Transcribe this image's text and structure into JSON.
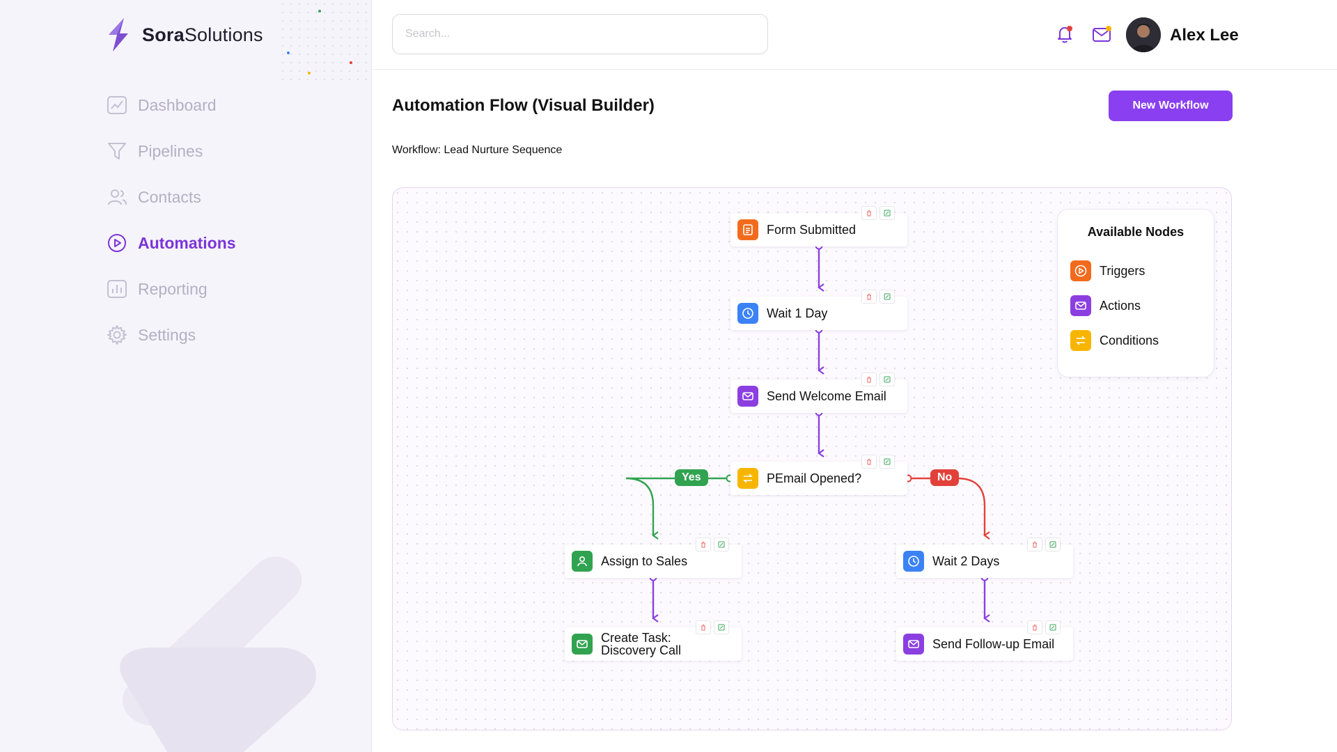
{
  "brand": {
    "name_bold": "Sora",
    "name_rest": "Solutions"
  },
  "search": {
    "placeholder": "Search..."
  },
  "user": {
    "name": "Alex Lee"
  },
  "sidebar": {
    "items": [
      {
        "label": "Dashboard",
        "icon": "chart-icon",
        "active": false
      },
      {
        "label": "Pipelines",
        "icon": "funnel-icon",
        "active": false
      },
      {
        "label": "Contacts",
        "icon": "users-icon",
        "active": false
      },
      {
        "label": "Automations",
        "icon": "play-circle-icon",
        "active": true
      },
      {
        "label": "Reporting",
        "icon": "bar-chart-icon",
        "active": false
      },
      {
        "label": "Settings",
        "icon": "gear-icon",
        "active": false
      }
    ]
  },
  "page": {
    "title": "Automation Flow (Visual Builder)",
    "new_button": "New Workflow",
    "workflow_label": "Workflow: Lead Nurture Sequence"
  },
  "flow": {
    "nodes": [
      {
        "label": "Form Submitted",
        "type": "trigger",
        "icon": "form-icon"
      },
      {
        "label": "Wait 1 Day",
        "type": "wait",
        "icon": "clock-icon"
      },
      {
        "label": "Send Welcome Email",
        "type": "action",
        "icon": "mail-icon"
      },
      {
        "label": "PEmail Opened?",
        "type": "condition",
        "icon": "swap-icon"
      },
      {
        "label": "Assign to Sales",
        "type": "assign",
        "icon": "user-icon"
      },
      {
        "label": "Wait 2 Days",
        "type": "wait",
        "icon": "clock-icon"
      },
      {
        "label": "Create Task:",
        "label2": "Discovery Call",
        "type": "task",
        "icon": "mail-icon"
      },
      {
        "label": "Send Follow-up Email",
        "type": "action",
        "icon": "mail-icon"
      }
    ],
    "branch_yes": "Yes",
    "branch_no": "No"
  },
  "palette": {
    "title": "Available Nodes",
    "items": [
      {
        "label": "Triggers",
        "icon": "play-circle-icon"
      },
      {
        "label": "Actions",
        "icon": "mail-icon"
      },
      {
        "label": "Conditions",
        "icon": "swap-icon"
      }
    ]
  },
  "colors": {
    "accent": "#8a3ff0",
    "trigger": "#f26b1d",
    "wait": "#3b82f6",
    "action": "#8b3fe0",
    "condition": "#f7b500",
    "success": "#31a350",
    "danger": "#e2413a"
  }
}
